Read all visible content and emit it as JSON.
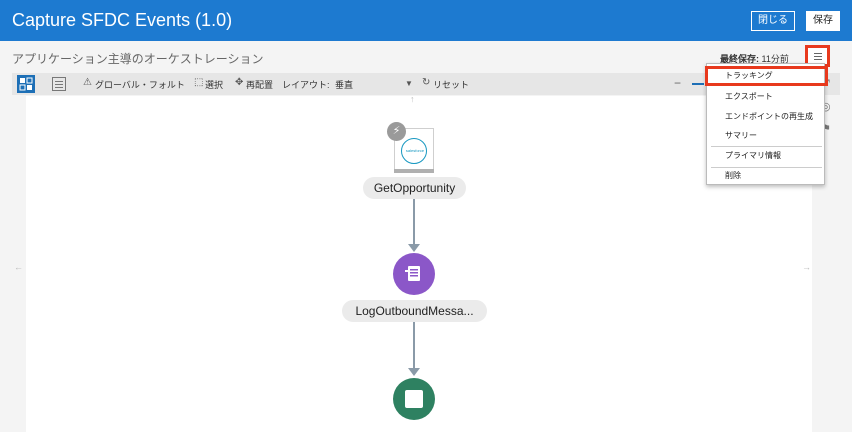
{
  "header": {
    "title": "Capture SFDC Events (1.0)",
    "close_label": "閉じる",
    "save_label": "保存"
  },
  "subheader": {
    "subtitle": "アプリケーション主導のオーケストレーション",
    "last_saved_label": "最終保存:",
    "last_saved_value": "11分前"
  },
  "toolbar": {
    "global_fault": "グローバル・フォルト",
    "select": "選択",
    "rearrange": "再配置",
    "layout_label": "レイアウト:",
    "layout_value": "垂直",
    "reset": "リセット"
  },
  "menu": {
    "items": [
      "トラッキング",
      "エクスポート",
      "エンドポイントの再生成",
      "サマリー",
      "プライマリ情報",
      "削除"
    ]
  },
  "flow": {
    "trigger_logo_text": "salesforce",
    "trigger_label": "GetOpportunity",
    "action_label": "LogOutboundMessa..."
  },
  "colors": {
    "header": "#1d7ad0",
    "highlight": "#e8391d",
    "log_node": "#8b57c8",
    "end_node": "#2e8161",
    "connector": "#8a9aa8"
  }
}
